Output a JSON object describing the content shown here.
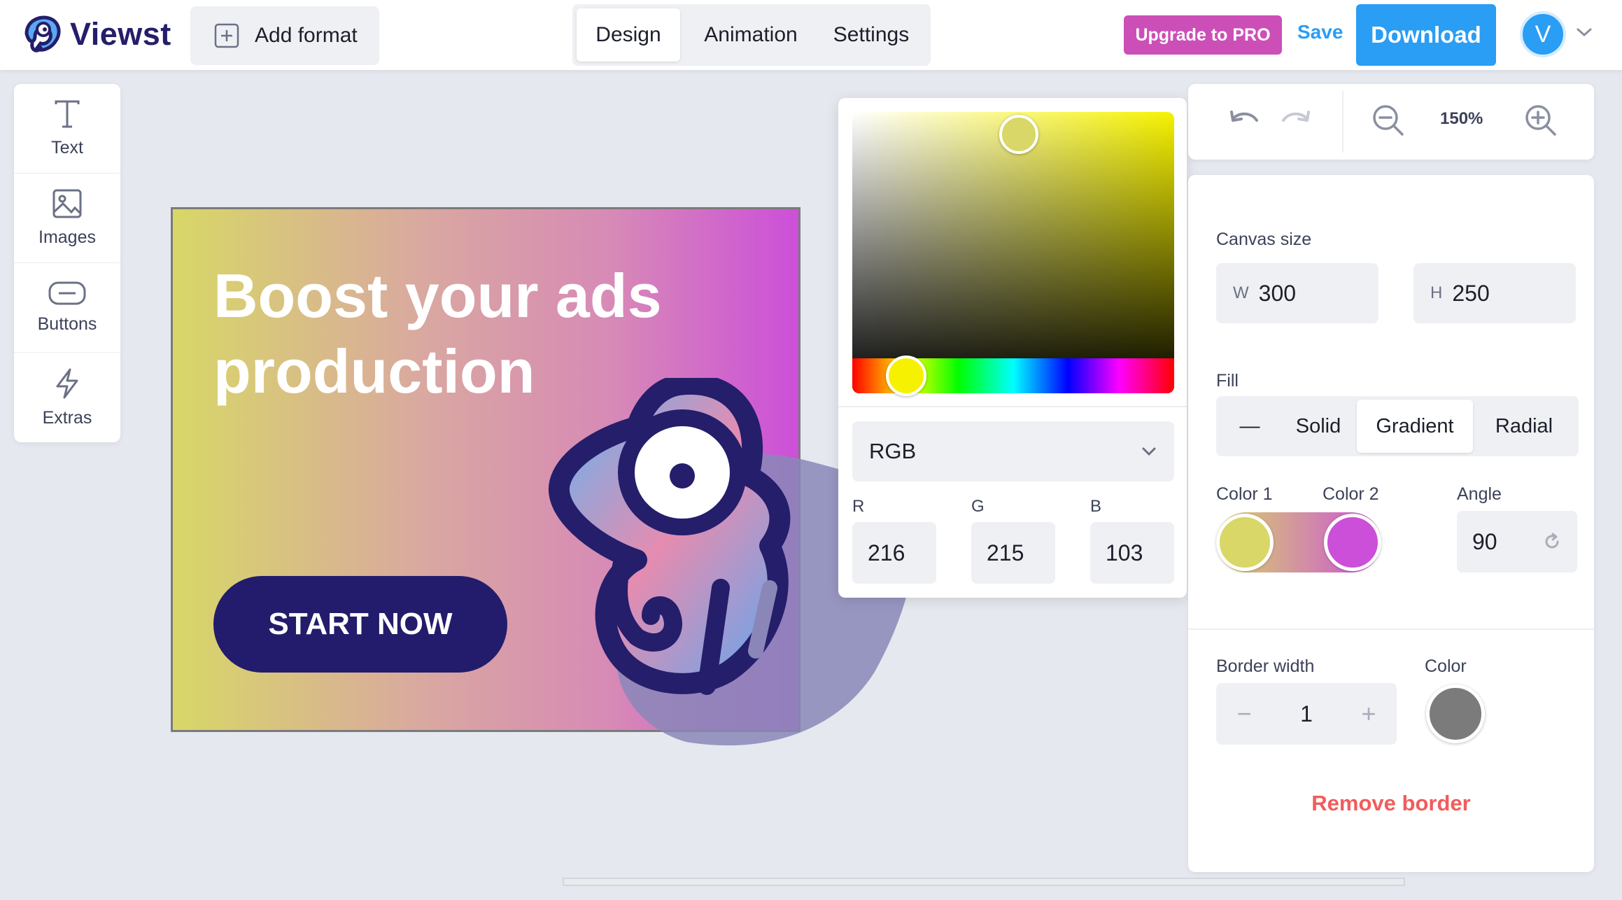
{
  "app": {
    "logo_text": "Viewst",
    "add_format_label": "Add format",
    "mode_tabs": [
      {
        "label": "Design",
        "active": true
      },
      {
        "label": "Animation",
        "active": false
      },
      {
        "label": "Settings",
        "active": false
      }
    ],
    "upgrade_label": "Upgrade to PRO",
    "save_label": "Save",
    "download_label": "Download",
    "avatar_initial": "V",
    "colors": {
      "brand": "#241e6b",
      "accent": "#2a9df4",
      "upgrade": "#cc4fb8",
      "danger": "#f35b5b"
    }
  },
  "tools": [
    {
      "label": "Text",
      "icon": "text-icon"
    },
    {
      "label": "Images",
      "icon": "image-icon"
    },
    {
      "label": "Buttons",
      "icon": "button-icon"
    },
    {
      "label": "Extras",
      "icon": "lightning-icon"
    }
  ],
  "canvas": {
    "headline": "Boost your ads production",
    "cta": "START NOW",
    "gradient_colors": [
      "#d8d767",
      "#cc4fd9"
    ]
  },
  "color_picker": {
    "mode": "RGB",
    "r_label": "R",
    "g_label": "G",
    "b_label": "B",
    "r": "216",
    "g": "215",
    "b": "103"
  },
  "zoom": {
    "level": "150%"
  },
  "properties": {
    "canvas_size_label": "Canvas size",
    "width_prefix": "W",
    "width": "300",
    "height_prefix": "H",
    "height": "250",
    "fill_label": "Fill",
    "fill_tabs": [
      {
        "label": "—",
        "active": false
      },
      {
        "label": "Solid",
        "active": false
      },
      {
        "label": "Gradient",
        "active": true
      },
      {
        "label": "Radial",
        "active": false
      }
    ],
    "color1_label": "Color 1",
    "color2_label": "Color 2",
    "color1": "#d8d767",
    "color2": "#cc4fd9",
    "angle_label": "Angle",
    "angle": "90",
    "border_width_label": "Border width",
    "border_width": "1",
    "stepper_minus": "−",
    "stepper_plus": "+",
    "border_color_label": "Color",
    "border_color": "#7b7b7b",
    "remove_border_label": "Remove border"
  }
}
